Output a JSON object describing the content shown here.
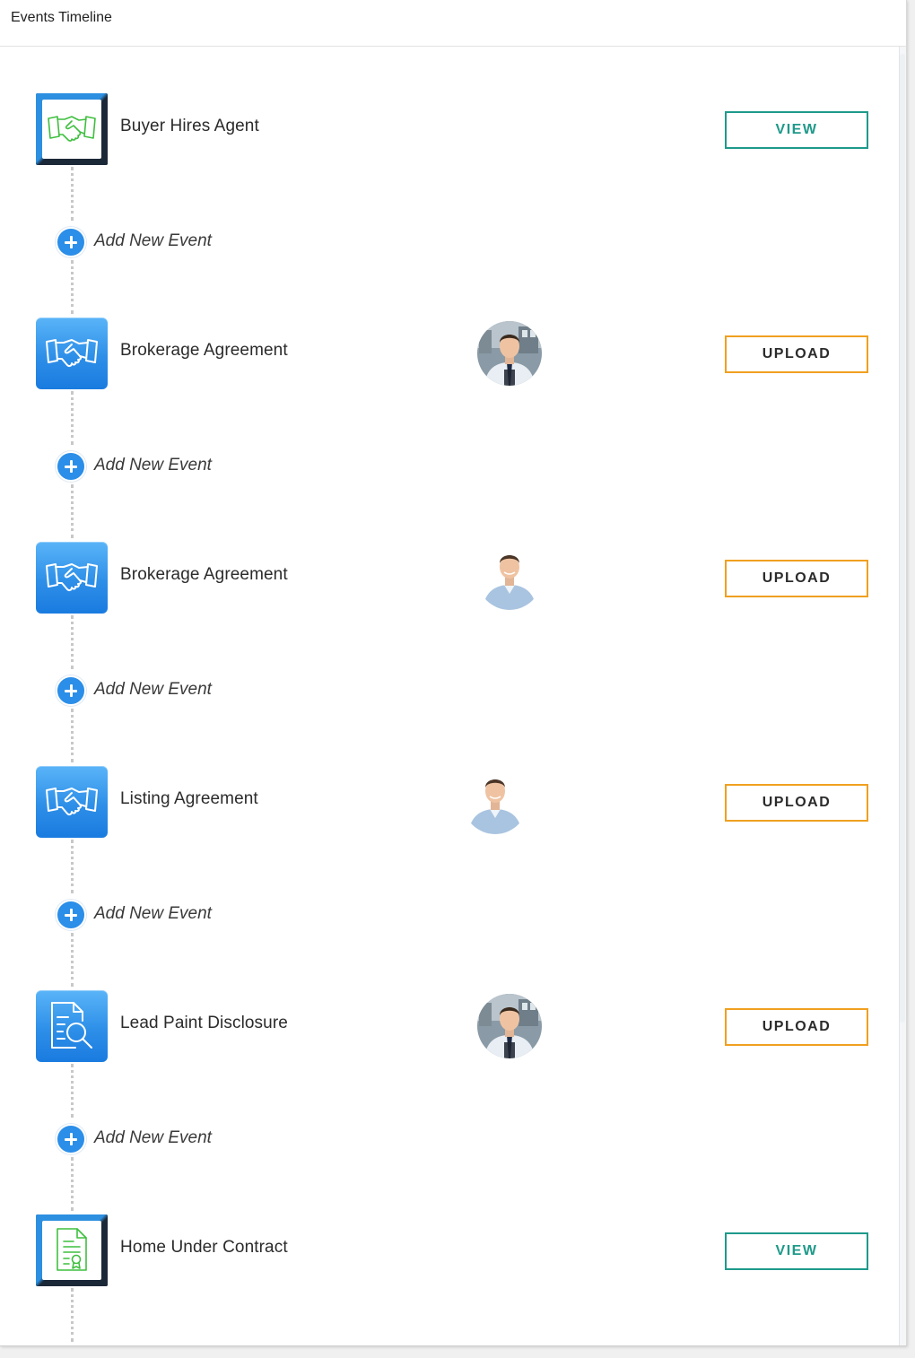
{
  "header": {
    "title": "Events Timeline"
  },
  "add_event_label": "Add New Event",
  "colors": {
    "accent_blue": "#2b8ee8",
    "view_teal": "#1e9a8a",
    "upload_orange": "#f0a020",
    "icon_green": "#3fbf3f"
  },
  "events": [
    {
      "title": "Buyer Hires Agent",
      "icon": "handshake-icon",
      "icon_style": "framed-green",
      "avatar": null,
      "action": "VIEW"
    },
    {
      "title": "Brokerage Agreement",
      "icon": "handshake-icon",
      "icon_style": "blue",
      "avatar": "agent-photo-suit",
      "action": "UPLOAD"
    },
    {
      "title": "Brokerage Agreement",
      "icon": "handshake-icon",
      "icon_style": "blue",
      "avatar": "agent-photo-casual",
      "action": "UPLOAD"
    },
    {
      "title": "Listing Agreement",
      "icon": "handshake-icon",
      "icon_style": "blue",
      "avatar": "agent-photo-casual",
      "action": "UPLOAD"
    },
    {
      "title": "Lead Paint Disclosure",
      "icon": "document-search-icon",
      "icon_style": "blue",
      "avatar": "agent-photo-suit",
      "action": "UPLOAD"
    },
    {
      "title": "Home Under Contract",
      "icon": "contract-certificate-icon",
      "icon_style": "framed-green",
      "avatar": null,
      "action": "VIEW"
    }
  ]
}
